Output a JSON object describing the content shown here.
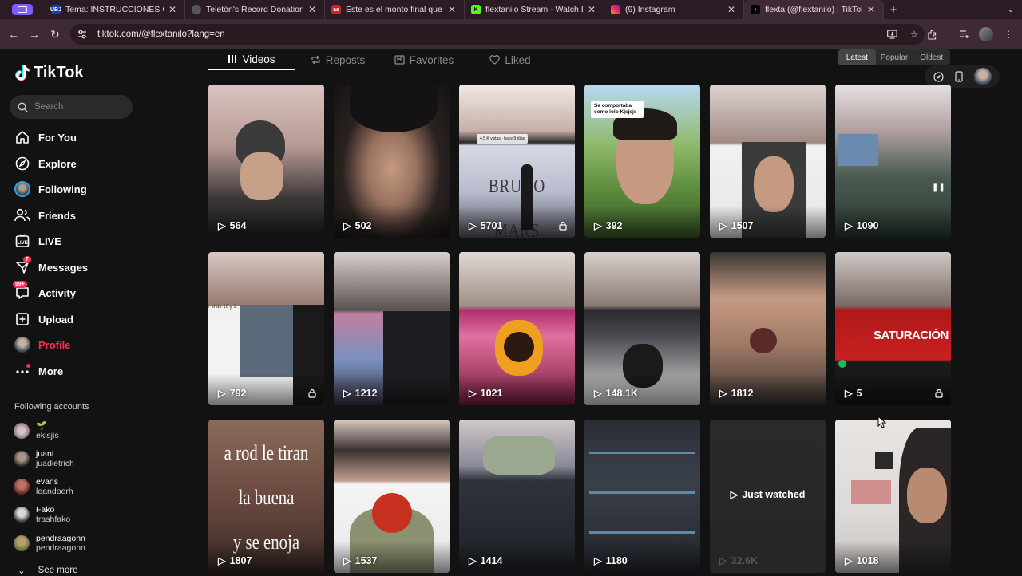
{
  "browser": {
    "tabs": [
      {
        "title": "Tema: INSTRUCCIONES CERT",
        "fav_color": "#1a3fa8",
        "fav_text": "UBJ"
      },
      {
        "title": "Teletón's Record Donations: A",
        "fav_color": "#555555",
        "fav_text": ""
      },
      {
        "title": "Este es el monto final que rec",
        "fav_color": "#d0202a",
        "fav_text": "as"
      },
      {
        "title": "flextanilo Stream - Watch Live",
        "fav_color": "#53fc18",
        "fav_text": "K"
      },
      {
        "title": "(9) Instagram",
        "fav_color": "#e1306c",
        "fav_text": ""
      },
      {
        "title": "flexta (@flextanilo) | TikTok",
        "fav_color": "#000000",
        "fav_text": "",
        "active": true
      }
    ],
    "url": "tiktok.com/@flextanilo?lang=en"
  },
  "sidebar": {
    "logo": "TikTok",
    "search_placeholder": "Search",
    "nav": [
      {
        "label": "For You",
        "icon": "home-icon"
      },
      {
        "label": "Explore",
        "icon": "compass-icon"
      },
      {
        "label": "Following",
        "icon": "following-avatar-icon"
      },
      {
        "label": "Friends",
        "icon": "friends-icon"
      },
      {
        "label": "LIVE",
        "icon": "live-icon"
      },
      {
        "label": "Messages",
        "icon": "messages-icon",
        "badge": "7"
      },
      {
        "label": "Activity",
        "icon": "activity-icon",
        "badge": "99+"
      },
      {
        "label": "Upload",
        "icon": "upload-icon"
      },
      {
        "label": "Profile",
        "icon": "profile-avatar-icon"
      },
      {
        "label": "More",
        "icon": "more-icon"
      }
    ],
    "following_title": "Following accounts",
    "accounts": [
      {
        "name": "🌱",
        "handle": "ekisjis"
      },
      {
        "name": "juani",
        "handle": "juadietrich"
      },
      {
        "name": "evans",
        "handle": "leandoerh"
      },
      {
        "name": "Fako",
        "handle": "trashfako"
      },
      {
        "name": "pendraagonn",
        "handle": "pendraagonn"
      }
    ],
    "see_more": "See more"
  },
  "profile_tabs": [
    "Videos",
    "Reposts",
    "Favorites",
    "Liked"
  ],
  "sort": [
    "Latest",
    "Popular",
    "Oldest"
  ],
  "videos": [
    {
      "views": "564",
      "locked": false
    },
    {
      "views": "502",
      "locked": false
    },
    {
      "views": "5701",
      "locked": true,
      "caption": "BRUNO MARS",
      "overlay": "4.5 K vistas · hace 9 días"
    },
    {
      "views": "392",
      "locked": false,
      "overlay": "Se comportaba como lolo Kjsjsjs"
    },
    {
      "views": "1507",
      "locked": false
    },
    {
      "views": "1090",
      "locked": false
    },
    {
      "views": "792",
      "locked": true,
      "overlay": "r el de 16 y 1"
    },
    {
      "views": "1212",
      "locked": false
    },
    {
      "views": "1021",
      "locked": false
    },
    {
      "views": "148.1K",
      "locked": false
    },
    {
      "views": "1812",
      "locked": false
    },
    {
      "views": "5",
      "locked": true,
      "caption": "SATURACIÓN"
    },
    {
      "views": "1807",
      "locked": false,
      "caption_lines": [
        "a rod le tiran",
        "la buena",
        "y se enoja"
      ]
    },
    {
      "views": "1537",
      "locked": false
    },
    {
      "views": "1414",
      "locked": false
    },
    {
      "views": "1180",
      "locked": false
    },
    {
      "views": "32.6K",
      "locked": false,
      "watched_label": "Just watched"
    },
    {
      "views": "1018",
      "locked": false
    }
  ]
}
